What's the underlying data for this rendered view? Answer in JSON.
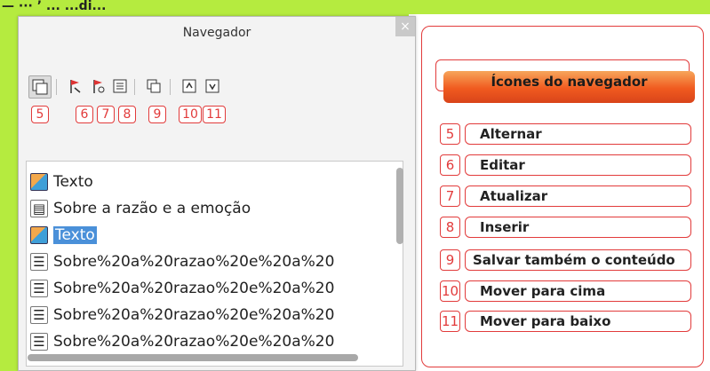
{
  "top_fragment": "— ··· ’ ... ...di...",
  "navigator": {
    "title": "Navegador",
    "close_symbol": "×",
    "toolbar": [
      {
        "name": "toggle",
        "glyph": "⧉",
        "active": true
      },
      {
        "name": "edit",
        "glyph": "⚑"
      },
      {
        "name": "update",
        "glyph": "⚑"
      },
      {
        "name": "insert",
        "glyph": "▤"
      },
      {
        "name": "save-content",
        "glyph": "⧉"
      },
      {
        "name": "move-up",
        "glyph": "⇞"
      },
      {
        "name": "move-down",
        "glyph": "⇟"
      }
    ],
    "badges": [
      "5",
      "6",
      "7",
      "8",
      "9",
      "10",
      "11"
    ],
    "tree": [
      {
        "icon": "image",
        "label": "Texto"
      },
      {
        "icon": "doc",
        "label": "Sobre a razão e a emoção"
      },
      {
        "icon": "image",
        "label": "Texto",
        "selected": true
      },
      {
        "icon": "text",
        "label": "Sobre%20a%20razao%20e%20a%20"
      },
      {
        "icon": "text",
        "label": "Sobre%20a%20razao%20e%20a%20"
      },
      {
        "icon": "text",
        "label": "Sobre%20a%20razao%20e%20a%20"
      },
      {
        "icon": "text",
        "label": "Sobre%20a%20razao%20e%20a%20"
      }
    ]
  },
  "legend": {
    "title": "Ícones do navegador",
    "items": [
      {
        "num": "5",
        "label": "Alternar"
      },
      {
        "num": "6",
        "label": "Editar"
      },
      {
        "num": "7",
        "label": "Atualizar"
      },
      {
        "num": "8",
        "label": "Inserir"
      },
      {
        "num": "9",
        "label": "Salvar também o conteúdo"
      },
      {
        "num": "10",
        "label": "Mover para cima"
      },
      {
        "num": "11",
        "label": "Mover para baixo"
      }
    ]
  },
  "colors": {
    "highlight": "#b5eb3f",
    "annotation": "#e23b3b",
    "header_orange": "#f05a1f",
    "selection": "#4a90d9"
  }
}
